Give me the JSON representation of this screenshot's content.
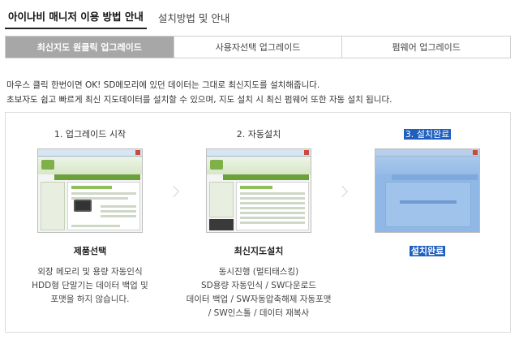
{
  "top_tabs": [
    {
      "label": "아이나비 매니저 이용 방법 안내",
      "active": true
    },
    {
      "label": "설치방법 및 안내",
      "active": false
    }
  ],
  "sub_tabs": [
    {
      "label": "최신지도 원클릭 업그레이드",
      "active": true
    },
    {
      "label": "사용자선택 업그레이드",
      "active": false
    },
    {
      "label": "펌웨어 업그레이드",
      "active": false
    }
  ],
  "description": {
    "line1": "마우스 클릭 한번이면 OK! SD메모리에 있던 데이터는 그대로 최신지도를 설치해줍니다.",
    "line2": "초보자도 쉽고 빠르게 최신 지도데이터를 설치할 수 있으며, 지도 설치 시 최신 펌웨어 또한 자동 설치 됩니다."
  },
  "steps": [
    {
      "title": "1. 업그레이드 시작",
      "name": "제품선택",
      "desc_lines": [
        "외장 메모리 및 용량 자동인식",
        "HDD형 단말기는 데이터 백업 및",
        "포맷을 하지 않습니다."
      ]
    },
    {
      "title": "2. 자동설치",
      "name": "최신지도설치",
      "desc_lines": [
        "동시진행 (멀티태스킹)",
        "SD용량 자동인식 / SW다운로드",
        "데이터 백업 / SW자동압축해제 자동포맷",
        "/ SW인스톨 / 데이터 재복사"
      ]
    },
    {
      "title": "3. 설치완료",
      "name": "설치완료",
      "desc_lines": []
    }
  ],
  "colors": {
    "active_subtab_bg": "#a7a7a7",
    "highlight": "#1f5fbf",
    "thumb_green": "#6aa13a",
    "thumb_blue": "#8fb8e6"
  }
}
